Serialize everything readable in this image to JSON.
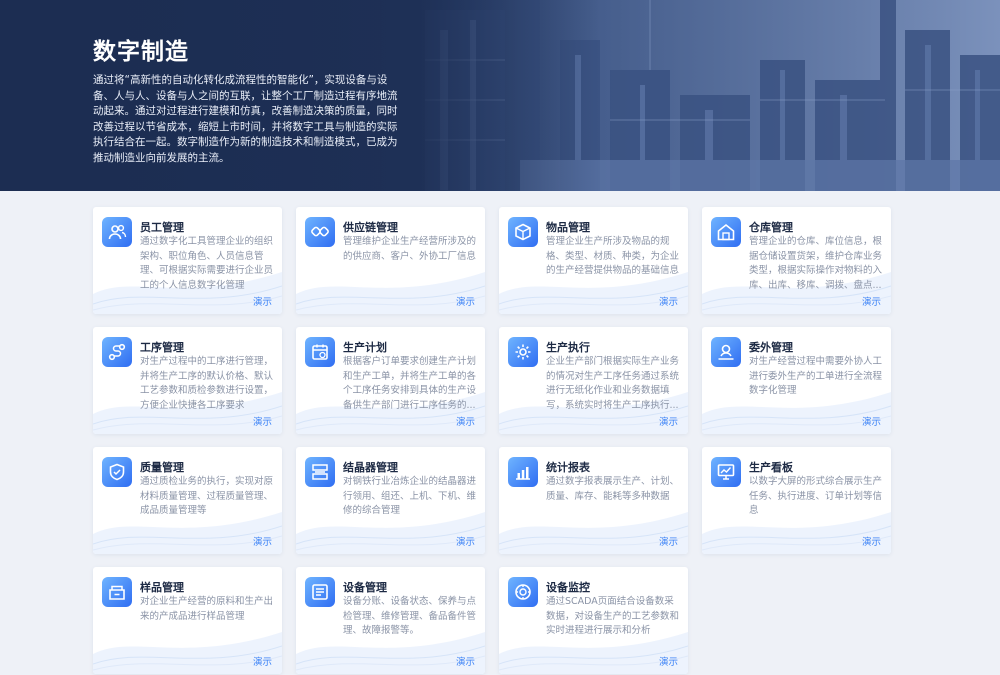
{
  "hero": {
    "title": "数字制造",
    "description": "通过将“高新性的自动化转化成流程性的智能化”，实现设备与设备、人与人、设备与人之间的互联，让整个工厂制造过程有序地流动起来。通过对过程进行建模和仿真，改善制造决策的质量，同时改善过程以节省成本，缩短上市时间，并将数字工具与制造的实际执行结合在一起。数字制造作为新的制造技术和制造模式，已成为推动制造业向前发展的主流。"
  },
  "demo_label": "演示",
  "cards": [
    {
      "title": "员工管理",
      "icon": "users-icon",
      "desc": "通过数字化工具管理企业的组织架构、职位角色、人员信息管理、可根据实际需要进行企业员工的个人信息数字化管理"
    },
    {
      "title": "供应链管理",
      "icon": "chain-icon",
      "desc": "管理维护企业生产经营所涉及的的供应商、客户、外协工厂信息"
    },
    {
      "title": "物品管理",
      "icon": "box-icon",
      "desc": "管理企业生产所涉及物品的规格、类型、材质、种类，为企业的生产经营提供物品的基础信息"
    },
    {
      "title": "仓库管理",
      "icon": "warehouse-icon",
      "desc": "管理企业的仓库、库位信息，根据仓储设置货架，维护仓库业务类型，根据实际操作对物料的入库、出库、移库、调拨、盘点..."
    },
    {
      "title": "工序管理",
      "icon": "process-icon",
      "desc": "对生产过程中的工序进行管理，并将生产工序的默认价格、默认工艺参数和质检参数进行设置，方便企业快捷各工序要求"
    },
    {
      "title": "生产计划",
      "icon": "calendar-icon",
      "desc": "根据客户订单要求创建生产计划和生产工单，并将生产工单的各个工序任务安排到具体的生产设备供生产部门进行工序任务的..."
    },
    {
      "title": "生产执行",
      "icon": "gear-icon",
      "desc": "企业生产部门根据实际生产业务的情况对生产工序任务通过系统进行无纸化作业和业务数据填写，系统实时将生产工序执行..."
    },
    {
      "title": "委外管理",
      "icon": "outsource-icon",
      "desc": "对生产经营过程中需要外协人工进行委外生产的工单进行全流程数字化管理"
    },
    {
      "title": "质量管理",
      "icon": "quality-icon",
      "desc": "通过质检业务的执行，实现对原材料质量管理、过程质量管理、成品质量管理等"
    },
    {
      "title": "结晶器管理",
      "icon": "crystallizer-icon",
      "desc": "对钢铁行业冶炼企业的结晶器进行领用、组还、上机、下机、维修的综合管理"
    },
    {
      "title": "统计报表",
      "icon": "chart-icon",
      "desc": "通过数字报表展示生产、计划、质量、库存、能耗等多种数据"
    },
    {
      "title": "生产看板",
      "icon": "dashboard-icon",
      "desc": "以数字大屏的形式综合展示生产任务、执行进度、订单计划等信息"
    },
    {
      "title": "样品管理",
      "icon": "sample-icon",
      "desc": "对企业生产经营的原料和生产出来的产成品进行样品管理"
    },
    {
      "title": "设备管理",
      "icon": "equipment-icon",
      "desc": "设备分账、设备状态、保养与点检管理、维修管理、备品备件管理、故障报警等。"
    },
    {
      "title": "设备监控",
      "icon": "monitor-icon",
      "desc": "通过SCADA页面结合设备数采数据，对设备生产的工艺参数和实时进程进行展示和分析"
    }
  ]
}
